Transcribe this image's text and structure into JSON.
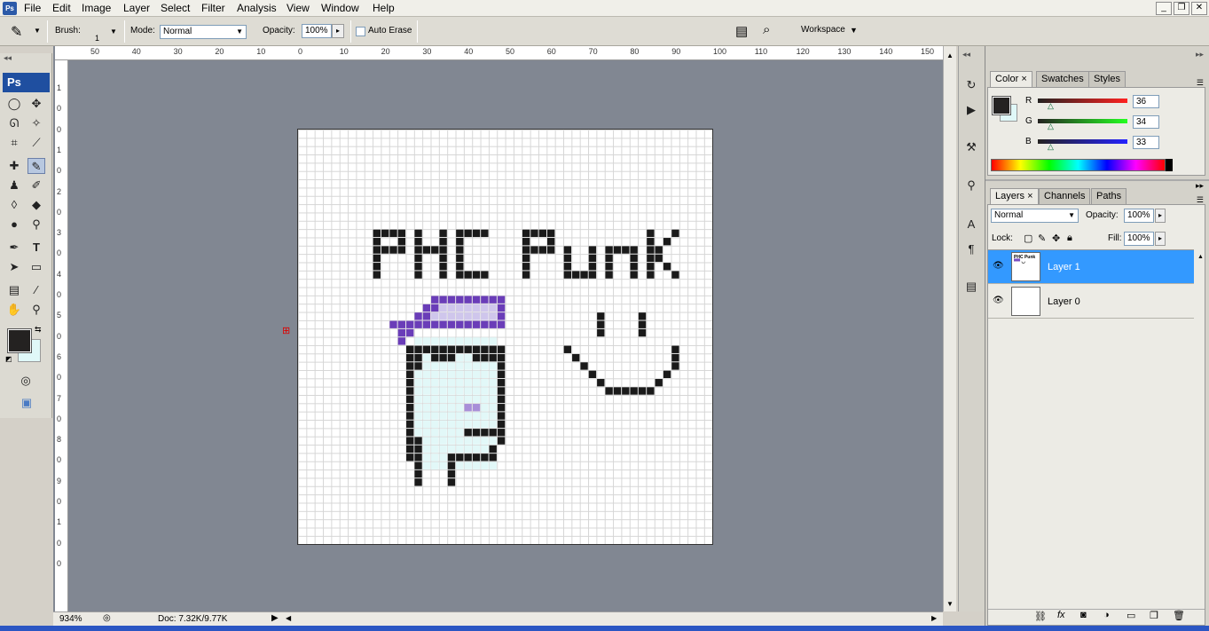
{
  "menu": {
    "app_icon": "Ps",
    "items": [
      "File",
      "Edit",
      "Image",
      "Layer",
      "Select",
      "Filter",
      "Analysis",
      "View",
      "Window",
      "Help"
    ]
  },
  "window_controls": {
    "minimize": "_",
    "restore": "❐",
    "close": "✕"
  },
  "options": {
    "brush_label": "Brush:",
    "brush_size": "1",
    "mode_label": "Mode:",
    "mode_value": "Normal",
    "opacity_label": "Opacity:",
    "opacity_value": "100%",
    "auto_erase": "Auto Erase",
    "workspace": "Workspace"
  },
  "toolbox": {
    "logo": "Ps"
  },
  "rulers": {
    "top": [
      "50",
      "40",
      "30",
      "20",
      "10",
      "0",
      "10",
      "20",
      "30",
      "40",
      "50",
      "60",
      "70",
      "80",
      "90",
      "100",
      "110",
      "120",
      "130",
      "140",
      "150"
    ],
    "left": [
      "1",
      "0",
      "0",
      "1",
      "0",
      "2",
      "0",
      "3",
      "0",
      "4",
      "0",
      "5",
      "0",
      "6",
      "0",
      "7",
      "0",
      "8",
      "0",
      "9",
      "0",
      "1",
      "0",
      "0"
    ]
  },
  "status": {
    "zoom": "934%",
    "doc": "Doc: 7.32K/9.77K"
  },
  "color_panel": {
    "tabs": [
      "Color",
      "Swatches",
      "Styles"
    ],
    "channels": [
      {
        "label": "R",
        "value": "36"
      },
      {
        "label": "G",
        "value": "34"
      },
      {
        "label": "B",
        "value": "33"
      }
    ],
    "fg": "#242221",
    "bg": "#e0f8f8"
  },
  "layers_panel": {
    "tabs": [
      "Layers",
      "Channels",
      "Paths"
    ],
    "blend": "Normal",
    "opacity_label": "Opacity:",
    "opacity_value": "100%",
    "lock_label": "Lock:",
    "fill_label": "Fill:",
    "fill_value": "100%",
    "layers": [
      {
        "name": "Layer 1",
        "selected": true
      },
      {
        "name": "Layer 0",
        "selected": false
      }
    ]
  },
  "colors": {
    "workspace": "#818792",
    "selection": "#3399ff"
  }
}
